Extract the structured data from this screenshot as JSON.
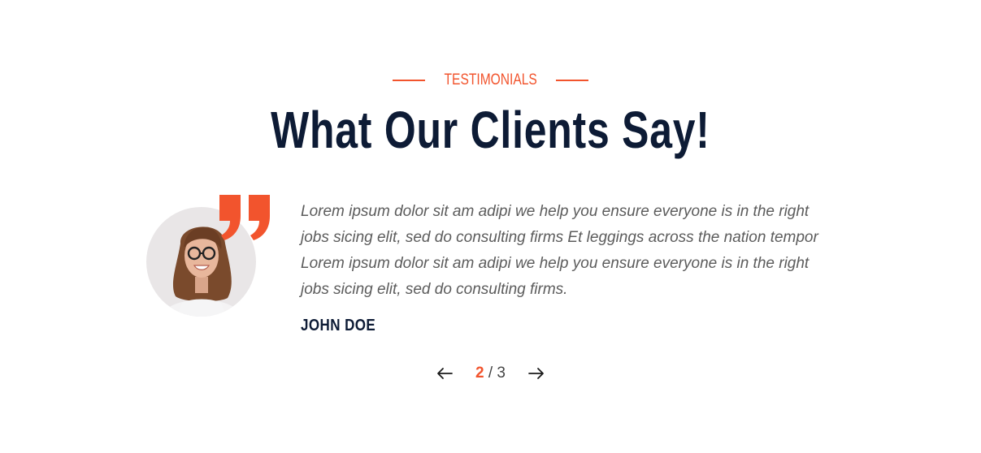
{
  "section": {
    "eyebrow": "TESTIMONIALS",
    "title": "What Our Clients Say!"
  },
  "testimonial": {
    "quote": "Lorem ipsum dolor sit am adipi we help you ensure everyone is in the right jobs sicing elit, sed do consulting firms Et leggings across the nation tempor Lorem ipsum dolor sit am adipi we help you ensure everyone is in the right jobs sicing elit, sed do consulting firms.",
    "author": "JOHN DOE",
    "avatar_icon": "person-avatar",
    "quote_icon": "quote-mark-icon"
  },
  "pager": {
    "current": "2",
    "separator": " / ",
    "total": "3",
    "prev_icon": "arrow-left-icon",
    "next_icon": "arrow-right-icon"
  },
  "colors": {
    "accent": "#f2542d",
    "heading": "#0d1b35",
    "body_text": "#5c5c5c"
  }
}
